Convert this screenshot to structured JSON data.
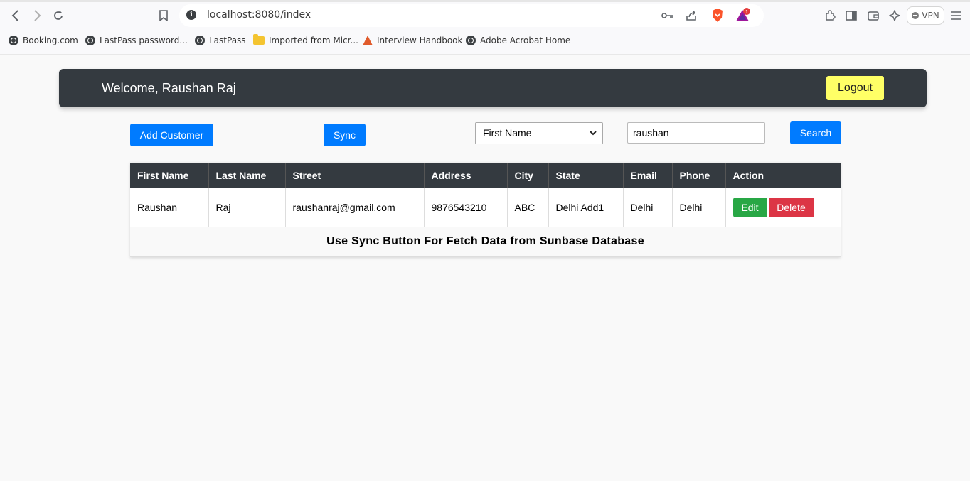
{
  "browser": {
    "url": "localhost:8080/index",
    "vpn_label": "VPN",
    "notification_count": "1",
    "bookmarks": [
      {
        "label": "Booking.com",
        "icon": "globe-icon"
      },
      {
        "label": "LastPass password...",
        "icon": "globe-icon"
      },
      {
        "label": "LastPass",
        "icon": "globe-icon"
      },
      {
        "label": "Imported from Micr...",
        "icon": "folder-icon"
      },
      {
        "label": "Interview Handbook",
        "icon": "handbook-icon"
      },
      {
        "label": "Adobe Acrobat Home",
        "icon": "globe-icon"
      }
    ]
  },
  "header": {
    "welcome": "Welcome, Raushan Raj",
    "logout_label": "Logout"
  },
  "controls": {
    "add_customer_label": "Add Customer",
    "sync_label": "Sync",
    "search_field_selected": "First Name",
    "search_value": "raushan",
    "search_label": "Search"
  },
  "table": {
    "headers": [
      "First Name",
      "Last Name",
      "Street",
      "Address",
      "City",
      "State",
      "Email",
      "Phone",
      "Action"
    ],
    "rows": [
      {
        "cells": [
          "Raushan",
          "Raj",
          "raushanraj@gmail.com",
          "9876543210",
          "ABC",
          "Delhi Add1",
          "Delhi",
          "Delhi"
        ],
        "edit_label": "Edit",
        "delete_label": "Delete"
      }
    ],
    "footer_note": "Use Sync Button For Fetch Data from Sunbase Database"
  },
  "colors": {
    "navbar": "#343a40",
    "logout": "#ffff66",
    "primary": "#007bff",
    "edit": "#28a745",
    "delete": "#dc3545"
  }
}
